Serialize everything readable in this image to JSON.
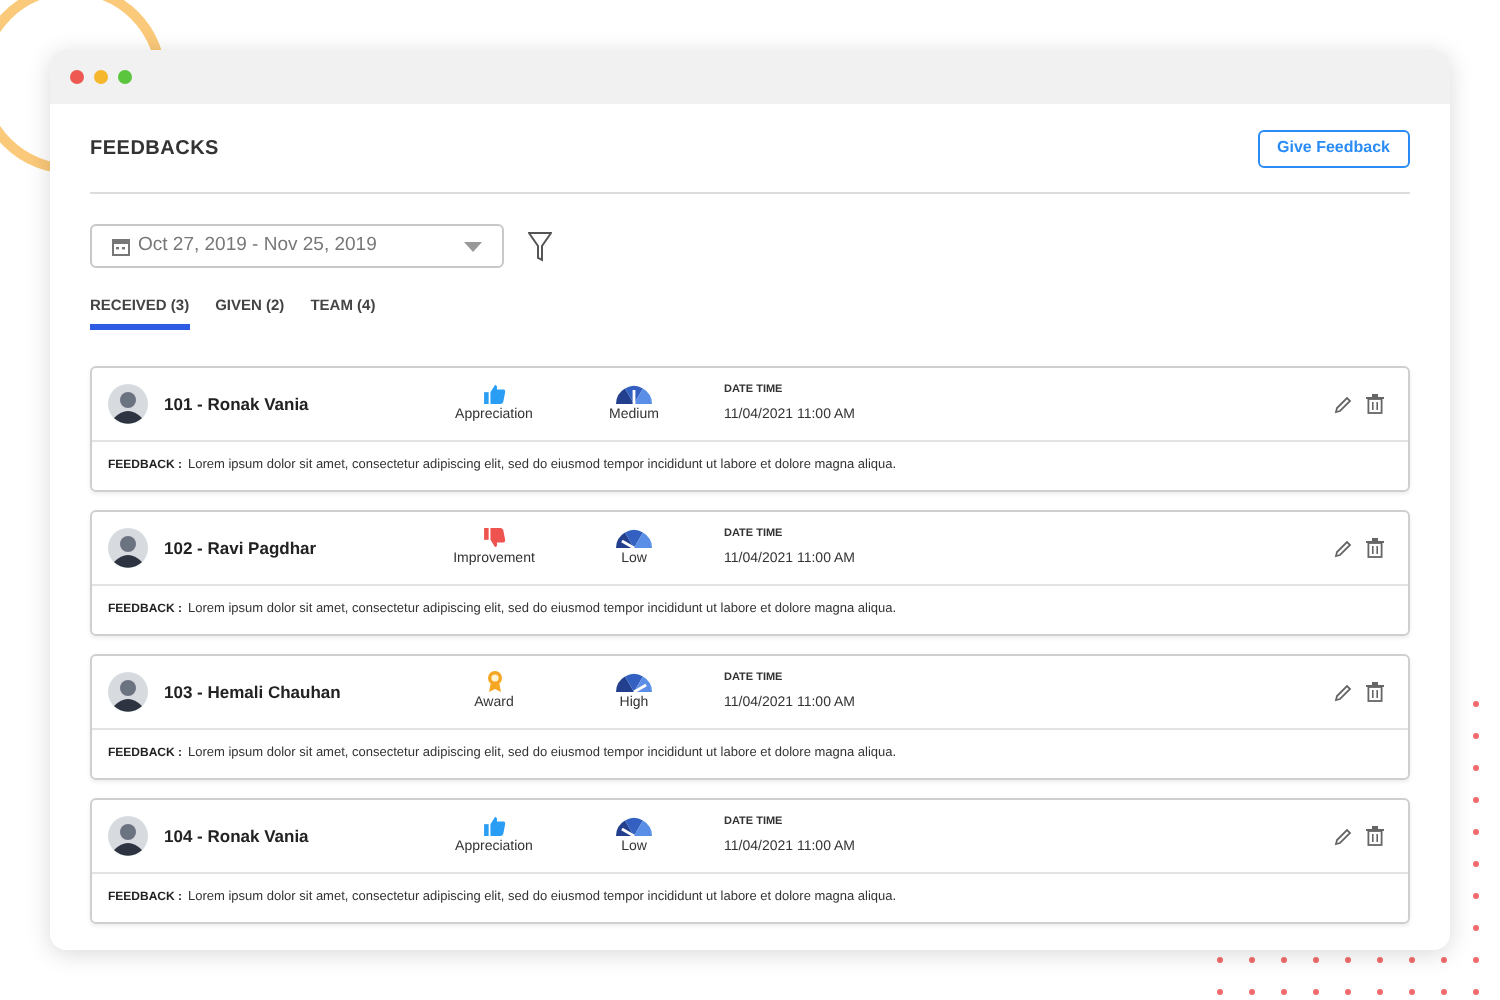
{
  "page": {
    "title": "FEEDBACKS",
    "action": "Give Feedback"
  },
  "date_range": {
    "value": "Oct 27, 2019 - Nov 25, 2019"
  },
  "tabs": [
    {
      "label": "RECEIVED (3)",
      "selected": true
    },
    {
      "label": "GIVEN (2)",
      "selected": false
    },
    {
      "label": "TEAM (4)",
      "selected": false
    }
  ],
  "feedbacks": [
    {
      "name": "101 - Ronak Vania",
      "type": {
        "kind": "appreciation",
        "label": "Appreciation"
      },
      "priority": {
        "kind": "medium",
        "label": "Medium"
      },
      "date_label": "DATE TIME",
      "date": "11/04/2021 11:00 AM",
      "feedback_label": "FEEDBACK :",
      "feedback": "Lorem ipsum dolor sit amet, consectetur adipiscing elit, sed do eiusmod tempor incididunt ut labore et dolore magna aliqua."
    },
    {
      "name": "102 - Ravi Pagdhar",
      "type": {
        "kind": "improvement",
        "label": "Improvement"
      },
      "priority": {
        "kind": "low",
        "label": "Low"
      },
      "date_label": "DATE TIME",
      "date": "11/04/2021 11:00 AM",
      "feedback_label": "FEEDBACK :",
      "feedback": "Lorem ipsum dolor sit amet, consectetur adipiscing elit, sed do eiusmod tempor incididunt ut labore et dolore magna aliqua."
    },
    {
      "name": "103 - Hemali Chauhan",
      "type": {
        "kind": "award",
        "label": "Award"
      },
      "priority": {
        "kind": "high",
        "label": "High"
      },
      "date_label": "DATE TIME",
      "date": "11/04/2021 11:00 AM",
      "feedback_label": "FEEDBACK :",
      "feedback": "Lorem ipsum dolor sit amet, consectetur adipiscing elit, sed do eiusmod tempor incididunt ut labore et dolore magna aliqua."
    },
    {
      "name": "104 - Ronak Vania",
      "type": {
        "kind": "appreciation",
        "label": "Appreciation"
      },
      "priority": {
        "kind": "low",
        "label": "Low"
      },
      "date_label": "DATE TIME",
      "date": "11/04/2021 11:00 AM",
      "feedback_label": "FEEDBACK :",
      "feedback": "Lorem ipsum dolor sit amet, consectetur adipiscing elit, sed do eiusmod tempor incididunt ut labore et dolore magna aliqua."
    }
  ]
}
